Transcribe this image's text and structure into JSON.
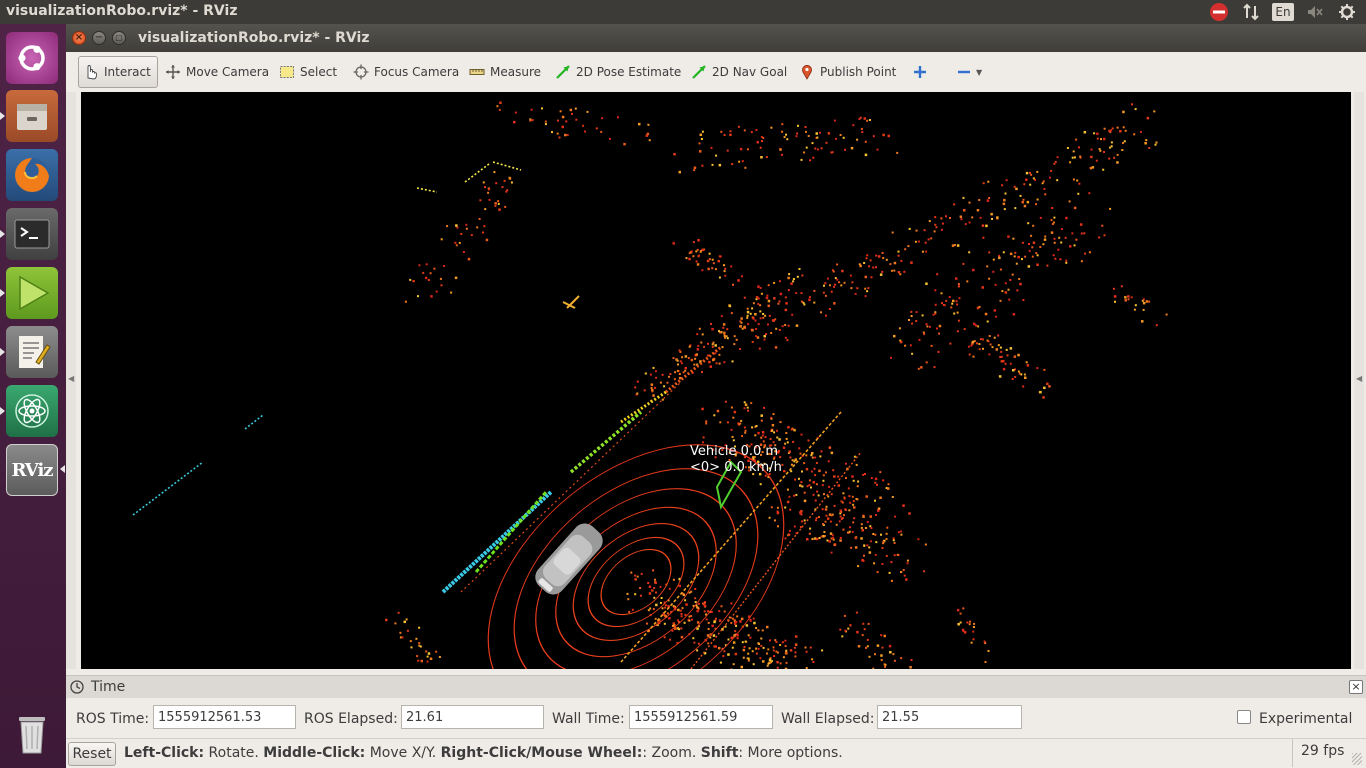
{
  "top_panel": {
    "title": "visualizationRobo.rviz* - RViz",
    "keyboard_layout": "En"
  },
  "launcher": {
    "items": [
      {
        "name": "ubuntu-dash",
        "icon": "ubuntu-logo-icon"
      },
      {
        "name": "files",
        "icon": "file-manager-icon"
      },
      {
        "name": "firefox",
        "icon": "firefox-icon"
      },
      {
        "name": "terminal",
        "icon": "terminal-icon"
      },
      {
        "name": "media-player",
        "icon": "play-icon"
      },
      {
        "name": "text-editor",
        "icon": "text-editor-icon"
      },
      {
        "name": "atom",
        "icon": "atom-icon"
      },
      {
        "name": "rviz",
        "icon": "rviz-icon",
        "label": "RViz"
      },
      {
        "name": "trash",
        "icon": "trash-icon"
      }
    ]
  },
  "window": {
    "title": "visualizationRobo.rviz* - RViz"
  },
  "toolbar": {
    "interact": "Interact",
    "move_camera": "Move Camera",
    "select": "Select",
    "focus_camera": "Focus Camera",
    "measure": "Measure",
    "pose_estimate": "2D Pose Estimate",
    "nav_goal": "2D Nav Goal",
    "publish_point": "Publish Point"
  },
  "viewport": {
    "vehicle_label_line1": "Vehicle  0.0  m",
    "vehicle_label_line2": "<0>  0.0  km/h",
    "background": "#000000"
  },
  "time_panel": {
    "title": "Time",
    "ros_time_label": "ROS Time:",
    "ros_time_value": "1555912561.53",
    "ros_elapsed_label": "ROS Elapsed:",
    "ros_elapsed_value": "21.61",
    "wall_time_label": "Wall Time:",
    "wall_time_value": "1555912561.59",
    "wall_elapsed_label": "Wall Elapsed:",
    "wall_elapsed_value": "21.55",
    "experimental_label": "Experimental",
    "experimental_checked": false
  },
  "statusbar": {
    "reset_label": "Reset",
    "hint_left_click": "Left-Click:",
    "hint_rotate": " Rotate. ",
    "hint_middle_click": "Middle-Click:",
    "hint_move": " Move X/Y. ",
    "hint_right_click": "Right-Click/Mouse Wheel:",
    "hint_zoom": ": Zoom. ",
    "hint_shift": "Shift",
    "hint_more": ": More options.",
    "fps": "29 fps"
  }
}
